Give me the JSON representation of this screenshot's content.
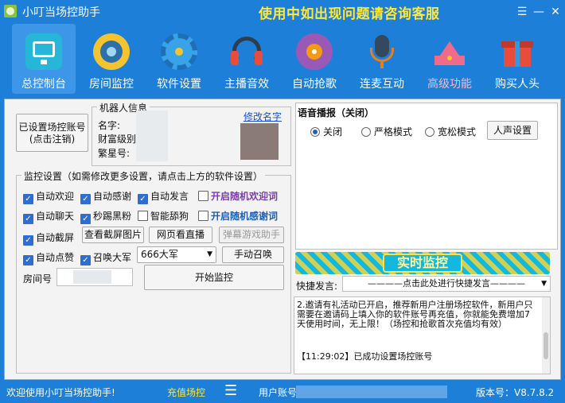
{
  "app": {
    "title": "小叮当场控助手",
    "banner": "使用中如出现问题请咨询客服"
  },
  "window": {
    "menu_icon": "☰",
    "minimize_icon": "—",
    "close_icon": "✕"
  },
  "nav": [
    {
      "label": "总控制台",
      "icon": "monitor-icon",
      "active": true
    },
    {
      "label": "房间监控",
      "icon": "camera-icon"
    },
    {
      "label": "软件设置",
      "icon": "gear-icon"
    },
    {
      "label": "主播音效",
      "icon": "headphones-icon"
    },
    {
      "label": "自动抢歌",
      "icon": "music-disc-icon"
    },
    {
      "label": "连麦互动",
      "icon": "microphone-icon"
    },
    {
      "label": "高级功能",
      "icon": "crown-icon"
    },
    {
      "label": "购买人头",
      "icon": "gift-icon"
    }
  ],
  "account": {
    "set_button_line1": "已设置场控账号",
    "set_button_line2": "(点击注销)"
  },
  "robot": {
    "legend": "机器人信息",
    "rename_link": "修改名字",
    "name_label": "名字:",
    "wealth_label": "财富级别:",
    "fan_label": "繁星号:"
  },
  "monitor": {
    "legend": "监控设置（如需修改更多设置，请点击上方的软件设置）",
    "checks": [
      {
        "label": "自动欢迎",
        "checked": true
      },
      {
        "label": "自动感谢",
        "checked": true
      },
      {
        "label": "自动发言",
        "checked": true
      },
      {
        "label": "开启随机欢迎词",
        "checked": false
      },
      {
        "label": "自动聊天",
        "checked": true
      },
      {
        "label": "秒踢黑粉",
        "checked": true
      },
      {
        "label": "智能舔狗",
        "checked": false
      },
      {
        "label": "开启随机感谢词",
        "checked": false
      },
      {
        "label": "自动截屏",
        "checked": true
      },
      {
        "label": "自动点赞",
        "checked": true
      },
      {
        "label": "召唤大军",
        "checked": true
      }
    ],
    "view_screenshot": "查看截屏图片",
    "web_live": "网页看直播",
    "danmaku_helper": "弹幕游戏助手",
    "army_select": "666大军",
    "manual_summon": "手动召唤",
    "room_label": "房间号",
    "start_button": "开始监控"
  },
  "voice": {
    "legend": "语音播报（关闭）",
    "options": [
      {
        "label": "关闭",
        "selected": true
      },
      {
        "label": "严格模式",
        "selected": false
      },
      {
        "label": "宽松模式",
        "selected": false
      }
    ],
    "settings_button": "人声设置"
  },
  "realtime": {
    "banner": "实时监控"
  },
  "quick": {
    "label": "快捷发言:",
    "dropdown": "————点击此处进行快捷发言————"
  },
  "log": {
    "message": "2.邀请有礼活动已开启，推荐新用户注册场控软件，新用户只需要在邀请码上填入你的软件账号再充值，你就能免费增加7天使用时间，无上限！（场控和抢歌首次充值均有效）",
    "entry": "【11:29:02】已成功设置场控账号"
  },
  "status": {
    "welcome": "欢迎使用小叮当场控助手!",
    "recharge": "充值场控",
    "menu_icon": "☰",
    "user_account": "用户账号",
    "version": "版本号：V8.7.8.2"
  }
}
